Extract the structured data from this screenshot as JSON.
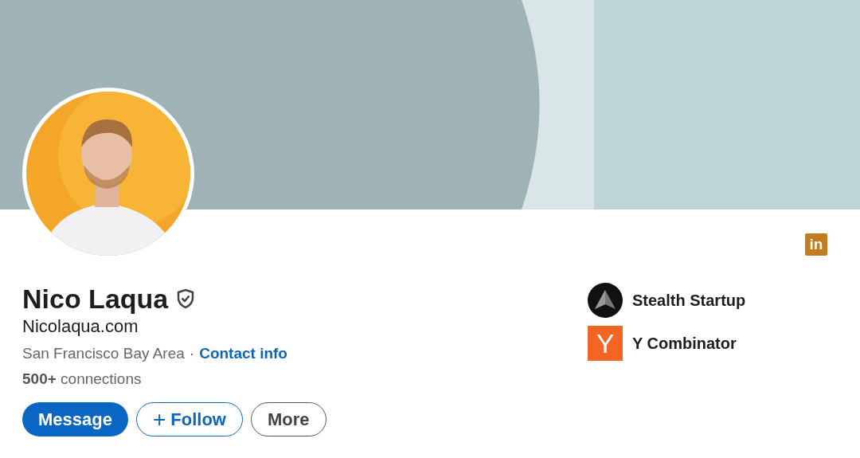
{
  "profile": {
    "name": "Nico Laqua",
    "verified": true,
    "website": "Nicolaqua.com",
    "location": "San Francisco Bay Area",
    "separator": "·",
    "contact_link": "Contact info",
    "connections_count": "500+",
    "connections_label": "connections"
  },
  "brand_badge": "in",
  "companies": [
    {
      "kind": "stealth",
      "name": "Stealth Startup"
    },
    {
      "kind": "letter",
      "logo_text": "Y",
      "name": "Y Combinator"
    }
  ],
  "buttons": [
    {
      "kind": "primary",
      "label": "Message"
    },
    {
      "kind": "outline",
      "icon": "+",
      "label": "Follow"
    },
    {
      "kind": "plain",
      "label": "More"
    }
  ]
}
